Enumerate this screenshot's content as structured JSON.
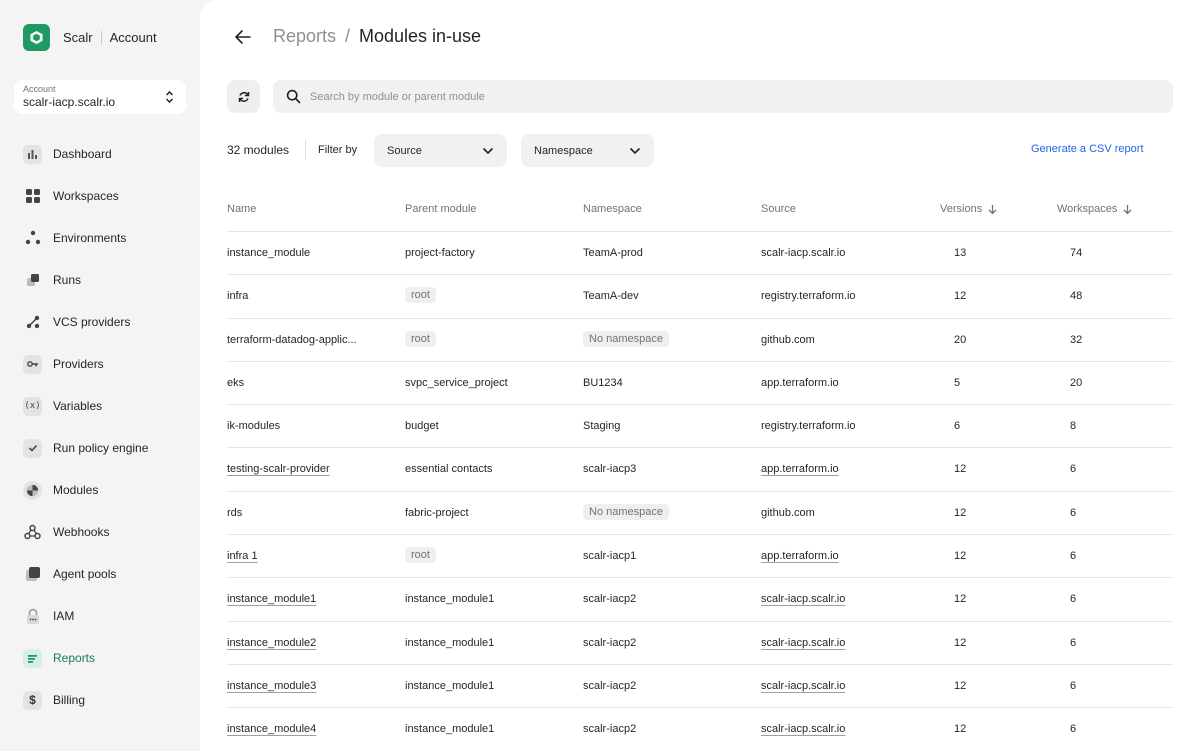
{
  "brand": {
    "name": "Scalr",
    "section": "Account"
  },
  "account": {
    "label": "Account",
    "value": "scalr-iacp.scalr.io"
  },
  "nav": [
    {
      "label": "Dashboard",
      "icon": "dashboard-icon"
    },
    {
      "label": "Workspaces",
      "icon": "workspaces-icon"
    },
    {
      "label": "Environments",
      "icon": "environments-icon"
    },
    {
      "label": "Runs",
      "icon": "runs-icon"
    },
    {
      "label": "VCS providers",
      "icon": "vcs-providers-icon"
    },
    {
      "label": "Providers",
      "icon": "providers-icon"
    },
    {
      "label": "Variables",
      "icon": "variables-icon"
    },
    {
      "label": "Run policy engine",
      "icon": "policy-icon"
    },
    {
      "label": "Modules",
      "icon": "modules-icon"
    },
    {
      "label": "Webhooks",
      "icon": "webhooks-icon"
    },
    {
      "label": "Agent pools",
      "icon": "agent-pools-icon"
    },
    {
      "label": "IAM",
      "icon": "iam-icon"
    },
    {
      "label": "Reports",
      "icon": "reports-icon",
      "active": true
    },
    {
      "label": "Billing",
      "icon": "billing-icon"
    }
  ],
  "header": {
    "breadcrumb_parent": "Reports",
    "breadcrumb_sep": "/",
    "title": "Modules in-use"
  },
  "search": {
    "placeholder": "Search by module or parent module",
    "value": ""
  },
  "toolbar": {
    "count": "32 modules",
    "filter_by": "Filter by",
    "source_label": "Source",
    "namespace_label": "Namespace",
    "csv_label": "Generate a CSV report"
  },
  "table": {
    "headers": [
      "Name",
      "Parent module",
      "Namespace",
      "Source",
      "Versions",
      "Workspaces"
    ],
    "rows": [
      {
        "name": "instance_module",
        "parent": "project-factory",
        "namespace": "TeamA-prod",
        "source": "scalr-iacp.scalr.io",
        "versions": "13",
        "workspaces": "74"
      },
      {
        "name": "infra",
        "parent": "root",
        "parent_chip": true,
        "namespace": "TeamA-dev",
        "source": "registry.terraform.io",
        "versions": "12",
        "workspaces": "48"
      },
      {
        "name": "terraform-datadog-applic...",
        "parent": "root",
        "parent_chip": true,
        "namespace": "No namespace",
        "ns_chip": true,
        "source": "github.com",
        "versions": "20",
        "workspaces": "32"
      },
      {
        "name": "eks",
        "parent": "svpc_service_project",
        "namespace": "BU1234",
        "source": "app.terraform.io",
        "versions": "5",
        "workspaces": "20"
      },
      {
        "name": "ik-modules",
        "parent": "budget",
        "namespace": "Staging",
        "source": "registry.terraform.io",
        "versions": "6",
        "workspaces": "8"
      },
      {
        "name": "testing-scalr-provider",
        "parent": "essential contacts",
        "namespace": "scalr-iacp3",
        "source": "app.terraform.io",
        "versions": "12",
        "workspaces": "6",
        "link": true
      },
      {
        "name": "rds",
        "parent": "fabric-project",
        "namespace": "No namespace",
        "ns_chip": true,
        "source": "github.com",
        "versions": "12",
        "workspaces": "6"
      },
      {
        "name": "infra 1",
        "parent": "root",
        "parent_chip": true,
        "namespace": "scalr-iacp1",
        "source": "app.terraform.io",
        "versions": "12",
        "workspaces": "6",
        "link": true
      },
      {
        "name": "instance_module1",
        "parent": "instance_module1",
        "namespace": "scalr-iacp2",
        "source": "scalr-iacp.scalr.io",
        "versions": "12",
        "workspaces": "6",
        "link": true
      },
      {
        "name": "instance_module2",
        "parent": "instance_module1",
        "namespace": "scalr-iacp2",
        "source": "scalr-iacp.scalr.io",
        "versions": "12",
        "workspaces": "6",
        "link": true
      },
      {
        "name": "instance_module3",
        "parent": "instance_module1",
        "namespace": "scalr-iacp2",
        "source": "scalr-iacp.scalr.io",
        "versions": "12",
        "workspaces": "6",
        "link": true
      },
      {
        "name": "instance_module4",
        "parent": "instance_module1",
        "namespace": "scalr-iacp2",
        "source": "scalr-iacp.scalr.io",
        "versions": "12",
        "workspaces": "6",
        "link": true
      }
    ]
  },
  "colors": {
    "accent": "#1f9a63",
    "link": "#2563eb",
    "active_text": "#1c7a52"
  }
}
